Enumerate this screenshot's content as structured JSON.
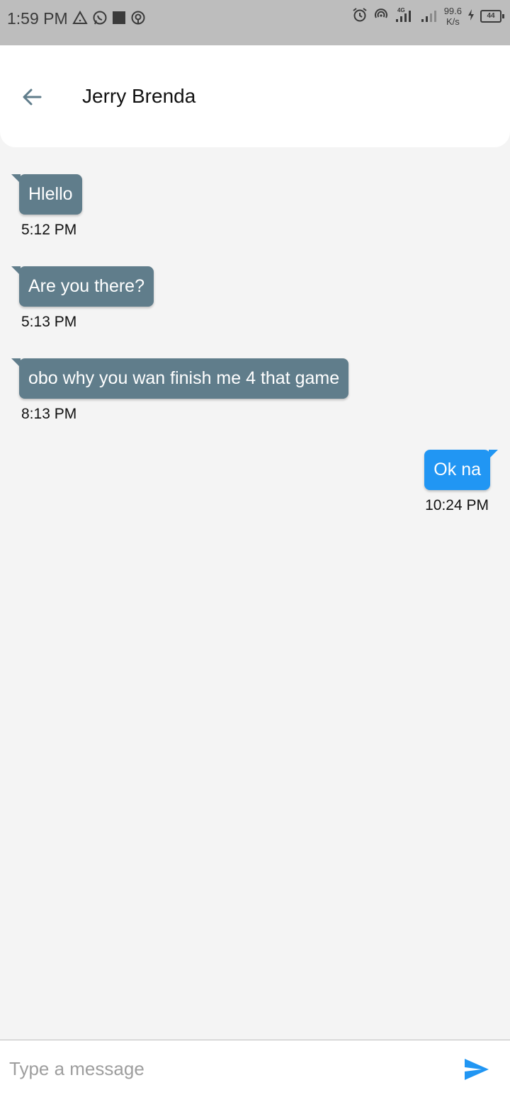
{
  "status_bar": {
    "time": "1:59 PM",
    "speed_value": "99.6",
    "speed_unit": "K/s",
    "battery": "44",
    "left_icons": [
      "warning-triangle-icon",
      "whatsapp-icon",
      "square-notification-icon",
      "hotspot-icon"
    ],
    "right_icons": [
      "alarm-icon",
      "hotspot-icon",
      "signal-4g-icon",
      "signal-icon",
      "charging-icon",
      "battery-icon"
    ]
  },
  "header": {
    "title": "Jerry Brenda",
    "back_icon": "arrow-back-icon"
  },
  "messages": [
    {
      "direction": "incoming",
      "text": "Hlello",
      "time": "5:12 PM"
    },
    {
      "direction": "incoming",
      "text": "Are you there?",
      "time": "5:13 PM"
    },
    {
      "direction": "incoming",
      "text": "obo why you wan finish me 4 that game",
      "time": "8:13 PM"
    },
    {
      "direction": "outgoing",
      "text": "Ok na",
      "time": "10:24 PM"
    }
  ],
  "composer": {
    "placeholder": "Type a message",
    "value": "",
    "send_icon": "send-icon"
  },
  "colors": {
    "incoming_bubble": "#607d8b",
    "outgoing_bubble": "#2196f3",
    "background": "#f4f4f4",
    "status_bar": "#bdbdbd",
    "accent": "#2196f3"
  }
}
